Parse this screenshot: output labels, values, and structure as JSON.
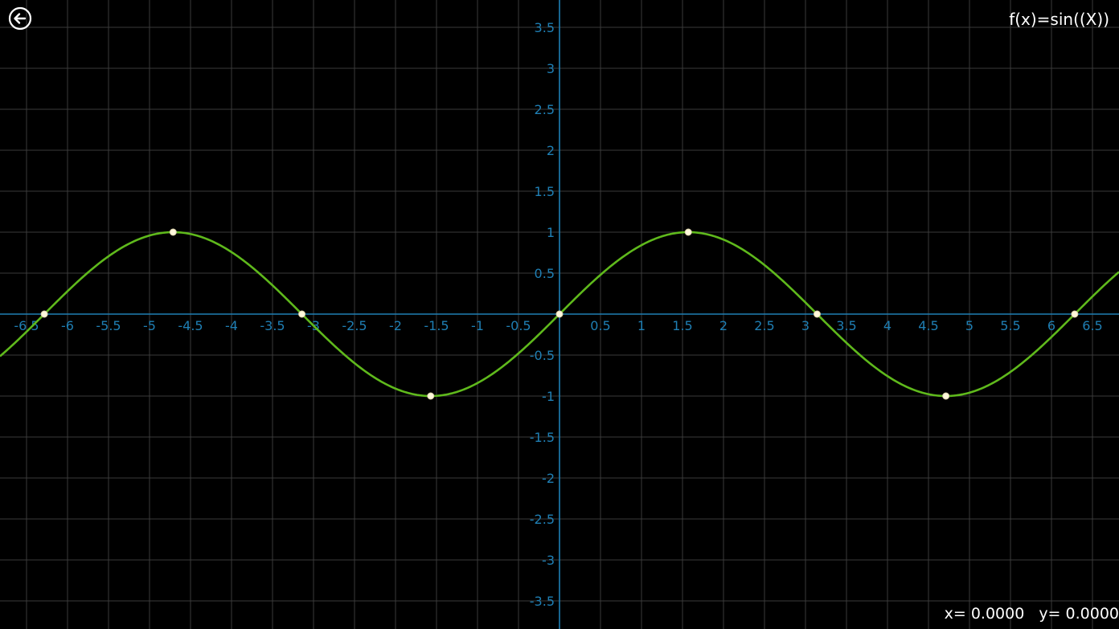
{
  "app": {
    "function_label": "f(x)=sin((X))",
    "readout": {
      "x_label": "x= 0.0000",
      "y_label": "y= 0.0000"
    },
    "icons": {
      "back": "back-arrow-icon"
    },
    "colors": {
      "background": "#000000",
      "grid": "#3a3a3a",
      "axis": "#1f7fb4",
      "tick_text": "#1f7fb4",
      "curve": "#5fb91c",
      "point": "#fff8dc",
      "text": "#ffffff"
    }
  },
  "chart_data": {
    "type": "line",
    "function": "sin(x)",
    "xlim": [
      -6.82,
      6.82
    ],
    "ylim": [
      -3.83,
      3.83
    ],
    "grid": true,
    "x_ticks": [
      "-6.5",
      "-6",
      "-5.5",
      "-5",
      "-4.5",
      "-4",
      "-3.5",
      "-3",
      "-2.5",
      "-2",
      "-1.5",
      "-1",
      "-0.5",
      "0.5",
      "1",
      "1.5",
      "2",
      "2.5",
      "3",
      "3.5",
      "4",
      "4.5",
      "5",
      "5.5",
      "6",
      "6.5"
    ],
    "y_ticks": [
      "3.5",
      "3",
      "2.5",
      "2",
      "1.5",
      "1",
      "0.5",
      "-0.5",
      "-1",
      "-1.5",
      "-2",
      "-2.5",
      "-3",
      "-3.5"
    ],
    "special_points": [
      {
        "x": -6.2832,
        "y": 0
      },
      {
        "x": -4.7124,
        "y": 1
      },
      {
        "x": -3.1416,
        "y": 0
      },
      {
        "x": -1.5708,
        "y": -1
      },
      {
        "x": 0,
        "y": 0
      },
      {
        "x": 1.5708,
        "y": 1
      },
      {
        "x": 3.1416,
        "y": 0
      },
      {
        "x": 4.7124,
        "y": -1
      },
      {
        "x": 6.2832,
        "y": 0
      }
    ]
  }
}
